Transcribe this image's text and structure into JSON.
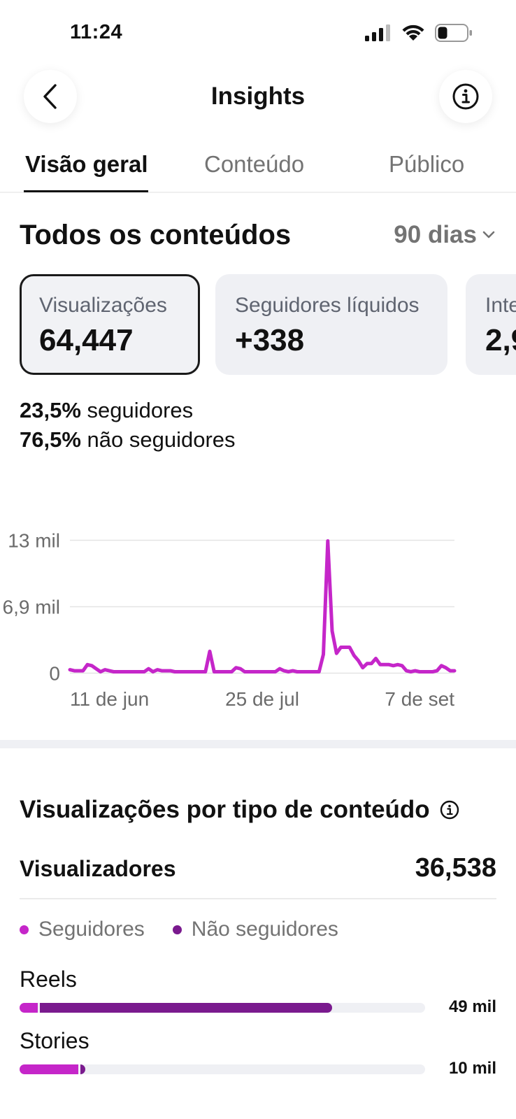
{
  "status_bar": {
    "time": "11:24"
  },
  "nav": {
    "title": "Insights"
  },
  "tabs": [
    {
      "label": "Visão geral",
      "active": true
    },
    {
      "label": "Conteúdo",
      "active": false
    },
    {
      "label": "Público",
      "active": false
    }
  ],
  "overview": {
    "title": "Todos os conteúdos",
    "range": "90 dias",
    "cards": [
      {
        "label": "Visualizações",
        "value": "64,447",
        "selected": true
      },
      {
        "label": "Seguidores líquidos",
        "value": "+338",
        "selected": false
      },
      {
        "label": "Inte",
        "value": "2,9",
        "selected": false
      }
    ],
    "breakdown": [
      {
        "pct": "23,5%",
        "text": " seguidores"
      },
      {
        "pct": "76,5%",
        "text": " não seguidores"
      }
    ]
  },
  "chart_data": {
    "type": "line",
    "y_tick_labels": [
      "13 mil",
      "6,9 mil",
      "0"
    ],
    "y_ticks": [
      13000,
      6500,
      0
    ],
    "ylim": [
      0,
      13000
    ],
    "x_tick_labels": [
      "11 de jun",
      "25 de jul",
      "7 de set"
    ],
    "x_ticks": [
      0,
      44,
      88
    ],
    "xlim": [
      0,
      88
    ],
    "grid": true,
    "color": "#c526c9",
    "x": [
      0,
      1,
      2,
      3,
      4,
      5,
      6,
      7,
      8,
      9,
      10,
      11,
      12,
      13,
      14,
      15,
      16,
      17,
      18,
      19,
      20,
      21,
      22,
      23,
      24,
      25,
      26,
      27,
      28,
      29,
      30,
      31,
      32,
      33,
      34,
      35,
      36,
      37,
      38,
      39,
      40,
      41,
      42,
      43,
      44,
      45,
      46,
      47,
      48,
      49,
      50,
      51,
      52,
      53,
      54,
      55,
      56,
      57,
      58,
      59,
      60,
      61,
      62,
      63,
      64,
      65,
      66,
      67,
      68,
      69,
      70,
      71,
      72,
      73,
      74,
      75,
      76,
      77,
      78,
      79,
      80,
      81,
      82,
      83,
      84,
      85,
      86,
      87,
      88
    ],
    "values": [
      300,
      200,
      200,
      200,
      800,
      700,
      400,
      100,
      300,
      200,
      100,
      100,
      100,
      100,
      100,
      100,
      100,
      100,
      400,
      100,
      300,
      200,
      200,
      200,
      100,
      100,
      100,
      100,
      100,
      100,
      100,
      100,
      2100,
      100,
      100,
      100,
      100,
      100,
      500,
      400,
      100,
      100,
      100,
      100,
      100,
      100,
      100,
      100,
      400,
      200,
      100,
      200,
      100,
      100,
      100,
      100,
      100,
      100,
      1800,
      12900,
      4100,
      1900,
      2500,
      2500,
      2500,
      1700,
      1200,
      500,
      900,
      900,
      1400,
      800,
      800,
      800,
      700,
      800,
      700,
      200,
      100,
      200,
      100,
      100,
      100,
      100,
      200,
      700,
      500,
      200,
      200
    ]
  },
  "content_type": {
    "title": "Visualizações por tipo de conteúdo",
    "viewers_label": "Visualizadores",
    "viewers_value": "36,538",
    "legend": [
      {
        "label": "Seguidores",
        "color": "#c526c9"
      },
      {
        "label": "Não seguidores",
        "color": "#7a1a8e"
      }
    ],
    "rows": [
      {
        "label": "Reels",
        "value": "49 mil",
        "followers_fraction": 0.045,
        "non_followers_fraction": 0.72
      },
      {
        "label": "Stories",
        "value": "10 mil",
        "followers_fraction": 0.145,
        "non_followers_fraction": 0.012
      }
    ]
  }
}
